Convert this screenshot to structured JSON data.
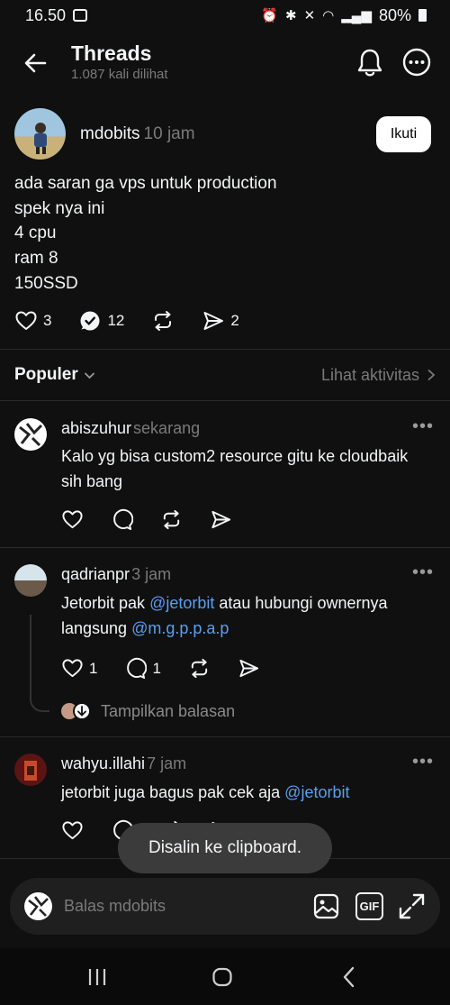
{
  "status_bar": {
    "time": "16.50",
    "battery": "80%"
  },
  "header": {
    "title": "Threads",
    "subtitle": "1.087 kali dilihat"
  },
  "post": {
    "username": "mdobits",
    "time": "10 jam",
    "follow_label": "Ikuti",
    "body": [
      "ada saran ga vps untuk production",
      "spek nya ini",
      "4 cpu",
      "ram 8",
      "150SSD"
    ],
    "likes": "3",
    "replies": "12",
    "shares": "2"
  },
  "sort": {
    "label": "Populer",
    "activity_label": "Lihat aktivitas"
  },
  "replies": [
    {
      "username": "abiszuhur",
      "time": "sekarang",
      "text_lines": [
        "Kalo yg bisa custom2 resource gitu ke cloudbaik",
        "sih bang"
      ]
    },
    {
      "username": "qadrianpr",
      "time": "3 jam",
      "text_parts": {
        "line1_pre": "Jetorbit pak ",
        "line1_mention": "@jetorbit",
        "line1_post": " atau hubungi ownernya",
        "line2_pre": "langsung ",
        "line2_mention": "@m.g.p.p.a.p"
      },
      "likes": "1",
      "replies": "1",
      "show_replies_label": "Tampilkan balasan"
    },
    {
      "username": "wahyu.illahi",
      "time": "7 jam",
      "text_parts": {
        "pre": "jetorbit juga bagus pak cek aja ",
        "mention": "@jetorbit"
      }
    }
  ],
  "toast": "Disalin ke clipboard.",
  "compose": {
    "placeholder": "Balas mdobits",
    "gif_label": "GIF"
  },
  "icons": {
    "back": "arrow-left-icon",
    "bell": "bell-icon",
    "more": "more-circle-icon",
    "like": "heart-icon",
    "reply": "comment-icon",
    "repost": "repost-icon",
    "share": "send-icon",
    "image": "image-icon",
    "gif": "gif-icon",
    "expand": "expand-icon"
  },
  "colors": {
    "background": "#101010",
    "mention": "#5b9ef0",
    "muted": "#7a7a7a"
  }
}
